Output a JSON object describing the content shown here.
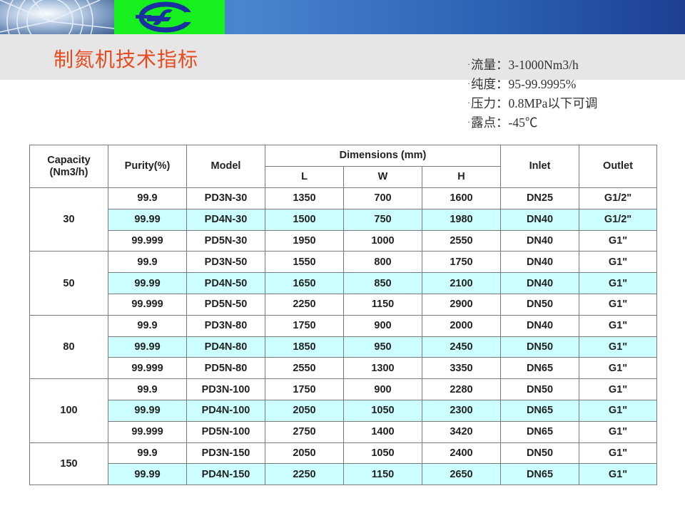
{
  "title": "制氮机技术指标",
  "specs": [
    {
      "label": "流量",
      "sep": "：",
      "value": "3-1000Nm3/h"
    },
    {
      "label": "纯度",
      "sep": "：",
      "value": "95-99.9995%"
    },
    {
      "label": "压力",
      "sep": "：",
      "value": "0.8MPa以下可调"
    },
    {
      "label": "露点",
      "sep": "：",
      "value": "-45℃"
    }
  ],
  "table": {
    "headers": {
      "capacity": "Capacity\n(Nm3/h)",
      "purity": "Purity(%)",
      "model": "Model",
      "dimensions": "Dimensions (mm)",
      "L": "L",
      "W": "W",
      "H": "H",
      "inlet": "Inlet",
      "outlet": "Outlet"
    },
    "groups": [
      {
        "capacity": "30",
        "rows": [
          {
            "purity": "99.9",
            "model": "PD3N-30",
            "L": "1350",
            "W": "700",
            "H": "1600",
            "inlet": "DN25",
            "outlet": "G1/2\""
          },
          {
            "purity": "99.99",
            "model": "PD4N-30",
            "L": "1500",
            "W": "750",
            "H": "1980",
            "inlet": "DN40",
            "outlet": "G1/2\""
          },
          {
            "purity": "99.999",
            "model": "PD5N-30",
            "L": "1950",
            "W": "1000",
            "H": "2550",
            "inlet": "DN40",
            "outlet": "G1\""
          }
        ]
      },
      {
        "capacity": "50",
        "rows": [
          {
            "purity": "99.9",
            "model": "PD3N-50",
            "L": "1550",
            "W": "800",
            "H": "1750",
            "inlet": "DN40",
            "outlet": "G1\""
          },
          {
            "purity": "99.99",
            "model": "PD4N-50",
            "L": "1650",
            "W": "850",
            "H": "2100",
            "inlet": "DN40",
            "outlet": "G1\""
          },
          {
            "purity": "99.999",
            "model": "PD5N-50",
            "L": "2250",
            "W": "1150",
            "H": "2900",
            "inlet": "DN50",
            "outlet": "G1\""
          }
        ]
      },
      {
        "capacity": "80",
        "rows": [
          {
            "purity": "99.9",
            "model": "PD3N-80",
            "L": "1750",
            "W": "900",
            "H": "2000",
            "inlet": "DN40",
            "outlet": "G1\""
          },
          {
            "purity": "99.99",
            "model": "PD4N-80",
            "L": "1850",
            "W": "950",
            "H": "2450",
            "inlet": "DN50",
            "outlet": "G1\""
          },
          {
            "purity": "99.999",
            "model": "PD5N-80",
            "L": "2550",
            "W": "1300",
            "H": "3350",
            "inlet": "DN65",
            "outlet": "G1\""
          }
        ]
      },
      {
        "capacity": "100",
        "rows": [
          {
            "purity": "99.9",
            "model": "PD3N-100",
            "L": "1750",
            "W": "900",
            "H": "2280",
            "inlet": "DN50",
            "outlet": "G1\""
          },
          {
            "purity": "99.99",
            "model": "PD4N-100",
            "L": "2050",
            "W": "1050",
            "H": "2300",
            "inlet": "DN65",
            "outlet": "G1\""
          },
          {
            "purity": "99.999",
            "model": "PD5N-100",
            "L": "2750",
            "W": "1400",
            "H": "3420",
            "inlet": "DN65",
            "outlet": "G1\""
          }
        ]
      },
      {
        "capacity": "150",
        "rows": [
          {
            "purity": "99.9",
            "model": "PD3N-150",
            "L": "2050",
            "W": "1050",
            "H": "2400",
            "inlet": "DN50",
            "outlet": "G1\""
          },
          {
            "purity": "99.99",
            "model": "PD4N-150",
            "L": "2250",
            "W": "1150",
            "H": "2650",
            "inlet": "DN65",
            "outlet": "G1\""
          }
        ]
      }
    ]
  },
  "colors": {
    "title": "#e8491d",
    "banner": "#2f5ba8",
    "logo_bg": "#17f01f",
    "alt_row": "#ccffff"
  },
  "icons": {
    "banner_photo": "fan-photo",
    "logo": "company-logo"
  }
}
